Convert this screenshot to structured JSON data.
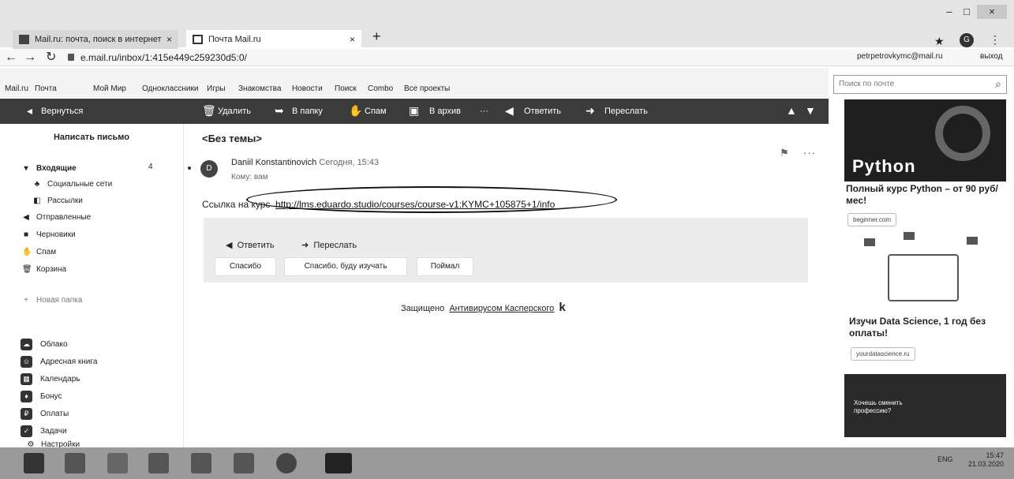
{
  "browser": {
    "tabs": [
      {
        "title": "Mail.ru: почта, поиск в интернет",
        "close": "×"
      },
      {
        "title": "Почта Mail.ru",
        "close": "×"
      }
    ],
    "new_tab": "+",
    "url": "e.mail.ru/inbox/1:415e449c259230d5:0/",
    "account_email": "petrpetrovkymc@mail.ru",
    "logout": "выход",
    "star": "★",
    "menu_dots": "⋮",
    "window_controls": {
      "minimize": "–",
      "maximize": "□",
      "close": "×"
    }
  },
  "portal": {
    "links": [
      "Mail.ru",
      "Почта",
      "Мой Мир",
      "Одноклассники",
      "Игры",
      "Знакомства",
      "Новости",
      "Поиск",
      "Combo",
      "Все проекты"
    ],
    "search_placeholder": "Поиск по почте"
  },
  "toolbar": {
    "back": "Вернуться",
    "delete": "Удалить",
    "to_folder": "В папку",
    "spam": "Спам",
    "archive": "В архив",
    "more": "···",
    "reply": "Ответить",
    "forward": "Переслать"
  },
  "sidebar": {
    "compose": "Написать письмо",
    "folders": [
      {
        "label": "Входящие",
        "count": "4"
      },
      {
        "label": "Социальные сети"
      },
      {
        "label": "Рассылки"
      },
      {
        "label": "Отправленные"
      },
      {
        "label": "Черновики"
      },
      {
        "label": "Спам"
      },
      {
        "label": "Корзина"
      }
    ],
    "new_folder": "Новая папка",
    "services": [
      "Облако",
      "Адресная книга",
      "Календарь",
      "Бонус",
      "Оплаты",
      "Задачи",
      "Настройки"
    ]
  },
  "message": {
    "subject": "<Без темы>",
    "avatar_letter": "D",
    "sender": "Daniil Konstantinovich",
    "time": "Сегодня, 15:43",
    "recipient": "Кому: вам",
    "body_prefix": "Ссылка на курс",
    "link": "http://lms.eduardo.studio/courses/course-v1:KYMC+105875+1/info",
    "reply_label": "Ответить",
    "forward_label": "Переслать",
    "quick_replies": [
      "Спасибо",
      "Спасибо, буду изучать",
      "Поймал"
    ],
    "protected_prefix": "Защищено",
    "protected_link": "Антивирусом Касперского",
    "protected_logo": "k"
  },
  "ads": {
    "python_brand": "Python",
    "python_title": "Полный курс Python – от 90 руб/мес!",
    "python_link": "beginner.com",
    "ds_title": "Изучи Data Science, 1 год без оплаты!",
    "ds_link": "yourdatascience.ru",
    "ad3_text": "Хочешь сменить профессию?"
  },
  "taskbar": {
    "lang": "ENG",
    "time": "15:47",
    "date": "21.03.2020"
  }
}
